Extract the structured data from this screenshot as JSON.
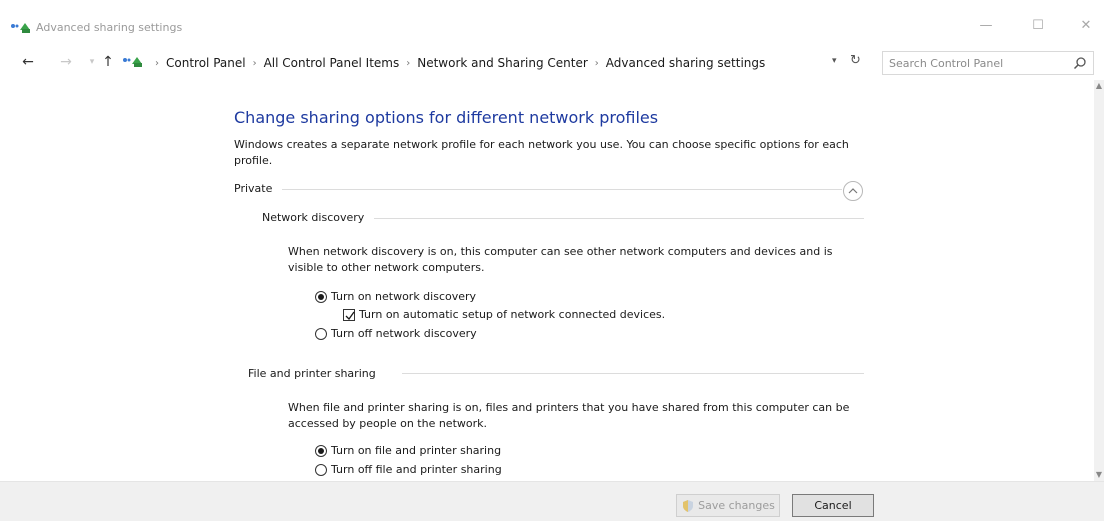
{
  "window": {
    "title": "Advanced sharing settings",
    "icon": "network-icon",
    "controls": [
      "minimize-icon",
      "maximize-icon",
      "close-icon"
    ]
  },
  "address_bar": {
    "breadcrumbs": [
      "Control Panel",
      "All Control Panel Items",
      "Network and Sharing Center",
      "Advanced sharing settings"
    ],
    "search_placeholder": "Search Control Panel"
  },
  "main": {
    "heading": "Change sharing options for different network profiles",
    "intro": "Windows creates a separate network profile for each network you use. You can choose specific options for each profile.",
    "profile": {
      "label": "Private",
      "expanded": true
    },
    "network_discovery": {
      "label": "Network discovery",
      "description": "When network discovery is on, this computer can see other network computers and devices and is visible to other network computers.",
      "options": [
        {
          "label": "Turn on network discovery",
          "selected": true
        },
        {
          "label": "Turn off network discovery",
          "selected": false
        }
      ],
      "auto_setup": {
        "label": "Turn on automatic setup of network connected devices.",
        "checked": true
      }
    },
    "file_printer_sharing": {
      "label": "File and printer sharing",
      "description": "When file and printer sharing is on, files and printers that you have shared from this computer can be accessed by people on the network.",
      "options": [
        {
          "label": "Turn on file and printer sharing",
          "selected": true
        },
        {
          "label": "Turn off file and printer sharing",
          "selected": false
        }
      ]
    }
  },
  "footer": {
    "save_label": "Save changes",
    "cancel_label": "Cancel"
  },
  "colors": {
    "heading": "#1e3aa0",
    "footer_bg": "#f0f0f0"
  }
}
